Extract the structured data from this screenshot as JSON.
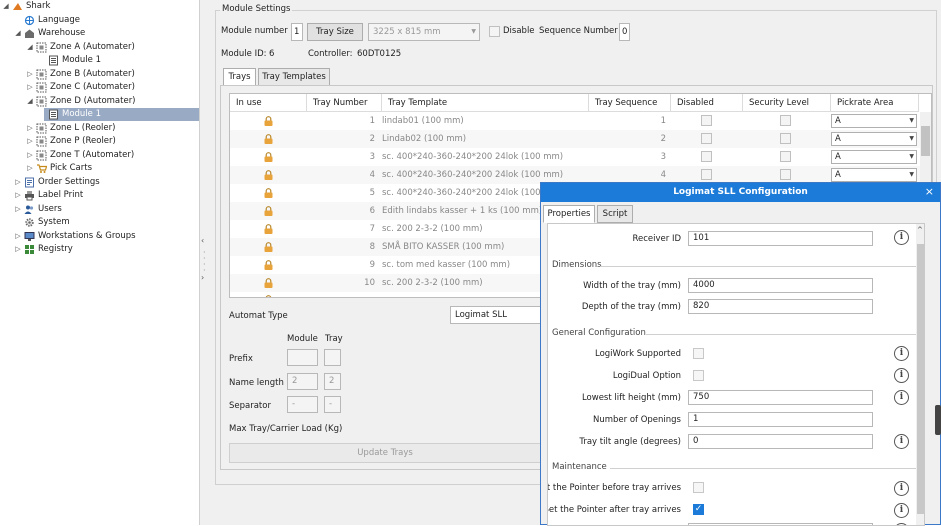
{
  "tree": {
    "items": [
      {
        "label": "Shark",
        "level": 0,
        "exp": "◢",
        "icon": "shark"
      },
      {
        "label": "Language",
        "level": 1,
        "exp": "",
        "icon": "language"
      },
      {
        "label": "Warehouse",
        "level": 1,
        "exp": "◢",
        "icon": "warehouse"
      },
      {
        "label": "Zone A (Automater)",
        "level": 2,
        "exp": "◢",
        "icon": "zone"
      },
      {
        "label": "Module 1",
        "level": 3,
        "exp": "",
        "icon": "module"
      },
      {
        "label": "Zone B (Automater)",
        "level": 2,
        "exp": "▷",
        "icon": "zone"
      },
      {
        "label": "Zone C (Automater)",
        "level": 2,
        "exp": "▷",
        "icon": "zone"
      },
      {
        "label": "Zone D (Automater)",
        "level": 2,
        "exp": "◢",
        "icon": "zone"
      },
      {
        "label": "Module 1",
        "level": 3,
        "exp": "",
        "icon": "module",
        "selected": true
      },
      {
        "label": "Zone L (Reoler)",
        "level": 2,
        "exp": "▷",
        "icon": "zone"
      },
      {
        "label": "Zone P (Reoler)",
        "level": 2,
        "exp": "▷",
        "icon": "zone"
      },
      {
        "label": "Zone T (Automater)",
        "level": 2,
        "exp": "▷",
        "icon": "zone"
      },
      {
        "label": "Pick Carts",
        "level": 2,
        "exp": "▷",
        "icon": "cart"
      },
      {
        "label": "Order Settings",
        "level": 1,
        "exp": "▷",
        "icon": "order"
      },
      {
        "label": "Label Print",
        "level": 1,
        "exp": "▷",
        "icon": "printer"
      },
      {
        "label": "Users",
        "level": 1,
        "exp": "▷",
        "icon": "users"
      },
      {
        "label": "System",
        "level": 1,
        "exp": "",
        "icon": "gear"
      },
      {
        "label": "Workstations & Groups",
        "level": 1,
        "exp": "▷",
        "icon": "workstation"
      },
      {
        "label": "Registry",
        "level": 1,
        "exp": "▷",
        "icon": "registry"
      }
    ]
  },
  "module_settings": {
    "title": "Module Settings",
    "module_number_label": "Module number",
    "module_number": "1",
    "tray_size_button": "Tray Size",
    "tray_size_value": "3225 x 815 mm",
    "disable_label": "Disable",
    "sequence_number_label": "Sequence Number",
    "sequence_number": "0",
    "module_id_label": "Module ID:",
    "module_id": "6",
    "controller_label": "Controller:",
    "controller": "60DT0125"
  },
  "tabs": {
    "trays": "Trays",
    "tray_templates": "Tray Templates"
  },
  "grid": {
    "headers": [
      "In use",
      "Tray Number",
      "Tray Template",
      "Tray Sequence",
      "Disabled",
      "Security Level",
      "Pickrate Area"
    ],
    "rows": [
      {
        "num": "1",
        "template": "lindab01 (100 mm)",
        "seq": "1",
        "area": "A"
      },
      {
        "num": "2",
        "template": "Lindab02 (100 mm)",
        "seq": "2",
        "area": "A"
      },
      {
        "num": "3",
        "template": "sc. 400*240-360-240*200 24lok (100 mm)",
        "seq": "3",
        "area": "A"
      },
      {
        "num": "4",
        "template": "sc. 400*240-360-240*200 24lok (100 mm)",
        "seq": "4",
        "area": "A"
      },
      {
        "num": "5",
        "template": "sc. 400*240-360-240*200 24lok (100 mm)",
        "seq": "",
        "area": ""
      },
      {
        "num": "6",
        "template": "Edith lindabs kasser + 1 ks (100 mm)",
        "seq": "",
        "area": ""
      },
      {
        "num": "7",
        "template": "sc. 200 2-3-2 (100 mm)",
        "seq": "",
        "area": ""
      },
      {
        "num": "8",
        "template": "SMÅ BITO KASSER  (100 mm)",
        "seq": "",
        "area": ""
      },
      {
        "num": "9",
        "template": "sc. tom med kasser (100 mm)",
        "seq": "",
        "area": ""
      },
      {
        "num": "10",
        "template": "sc. 200 2-3-2 (100 mm)",
        "seq": "",
        "area": ""
      }
    ]
  },
  "automat": {
    "type_label": "Automat Type",
    "type_value": "Logimat SLL",
    "col_module": "Module",
    "col_tray": "Tray",
    "prefix_label": "Prefix",
    "name_length_label": "Name length",
    "name_length_module": "2",
    "name_length_tray": "2",
    "separator_label": "Separator",
    "separator_module": "-",
    "separator_tray": "-",
    "max_load_label": "Max Tray/Carrier Load (Kg)",
    "update_button": "Update Trays"
  },
  "modal": {
    "title": "Logimat SLL Configuration",
    "close": "×",
    "tabs": {
      "properties": "Properties",
      "script": "Script"
    },
    "receiver_id_label": "Receiver ID",
    "receiver_id": "101",
    "dimensions_title": "Dimensions",
    "width_label": "Width of the tray (mm)",
    "width": "4000",
    "depth_label": "Depth of the tray (mm)",
    "depth": "820",
    "general_title": "General Configuration",
    "logiwork_label": "LogiWork Supported",
    "logidual_label": "LogiDual Option",
    "lowest_lift_label": "Lowest lift height (mm)",
    "lowest_lift": "750",
    "openings_label": "Number of Openings",
    "openings": "1",
    "tilt_label": "Tray tilt angle (degrees)",
    "tilt": "0",
    "maintenance_title": "Maintenance",
    "pointer_before_label": "Set the Pointer before tray arrives",
    "pointer_after_label": "Set the Pointer after tray arrives",
    "info_glyph": "i"
  },
  "colors": {
    "accent": "#1c7bd8",
    "selection": "#99aac4",
    "lock": "#e8a33a"
  }
}
